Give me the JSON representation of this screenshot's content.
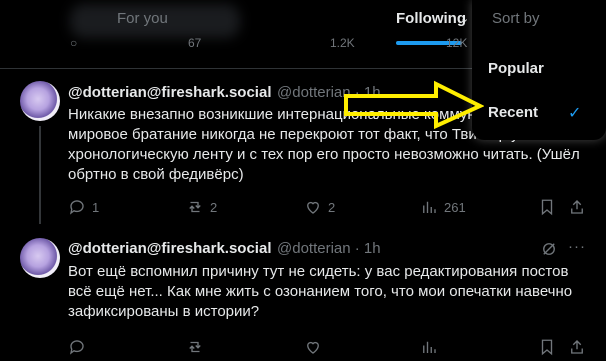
{
  "tabs": {
    "for_you": "For you",
    "following": "Following",
    "caret": "⌄"
  },
  "prev_actions": {
    "retweets": "67",
    "views": "1.2K",
    "views2": "12K"
  },
  "dropdown": {
    "title": "Sort by",
    "options": [
      "Popular",
      "Recent"
    ],
    "selected": "Recent",
    "check": "✓"
  },
  "tweets": [
    {
      "name": "@dotterian@fireshark.social",
      "handle": "@dotterian · 1h",
      "text": "Никакие внезапно возникшие интернациональные коммунистические мировое братание никогда не перекроют тот факт, что Твиттер убил хронологическую ленту и с тех пор его просто невозможно читать. (Ушёл обртно в свой федивёрс)",
      "replies": "1",
      "retweets": "2",
      "likes": "2",
      "views": "261"
    },
    {
      "name": "@dotterian@fireshark.social",
      "handle": "@dotterian · 1h",
      "text": "Вот ещё вспомнил причину тут не сидеть: у вас редактирования постов всё ещё нет... Как мне жить с озонанием того, что мои опечатки навечно зафиксированы в истории?",
      "replies": "",
      "retweets": "",
      "likes": "",
      "views": ""
    }
  ],
  "colors": {
    "accent": "#1d9bf0",
    "annotation": "#ffee00",
    "muted": "#71767b"
  }
}
